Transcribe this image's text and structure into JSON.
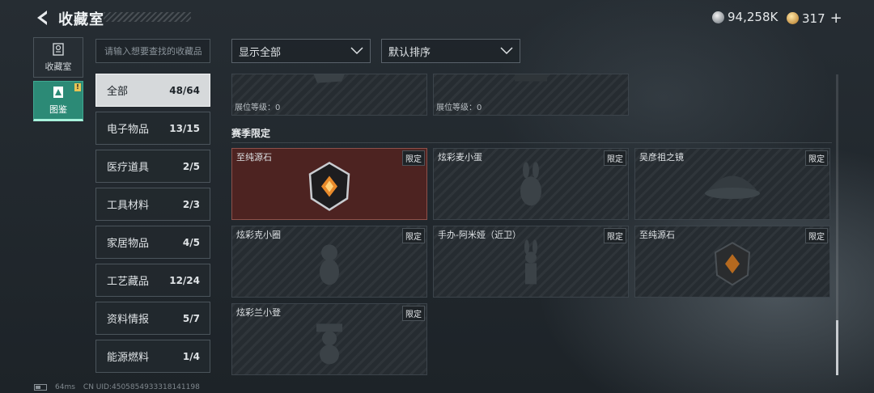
{
  "header": {
    "title": "收藏室",
    "currency_silver": "94,258K",
    "currency_gold": "317",
    "plus_label": "+"
  },
  "left_nav": {
    "tabs": [
      {
        "label": "收藏室"
      },
      {
        "label": "图鉴",
        "badge": "!"
      }
    ]
  },
  "search": {
    "placeholder": "请输入想要查找的收藏品"
  },
  "categories": [
    {
      "label": "全部",
      "count": "48/64"
    },
    {
      "label": "电子物品",
      "count": "13/15"
    },
    {
      "label": "医疗道具",
      "count": "2/5"
    },
    {
      "label": "工具材料",
      "count": "2/3"
    },
    {
      "label": "家居物品",
      "count": "4/5"
    },
    {
      "label": "工艺藏品",
      "count": "12/24"
    },
    {
      "label": "资料情报",
      "count": "5/7"
    },
    {
      "label": "能源燃料",
      "count": "1/4"
    }
  ],
  "filters": {
    "display": "显示全部",
    "sort": "默认排序"
  },
  "top_cards": [
    {
      "level": "展位等级：0"
    },
    {
      "level": "展位等级：0"
    }
  ],
  "section": {
    "title": "赛季限定"
  },
  "season_cards": [
    {
      "name": "至纯源石",
      "tag": "限定"
    },
    {
      "name": "炫彩麦小蛋",
      "tag": "限定"
    },
    {
      "name": "吴彦祖之镜",
      "tag": "限定"
    },
    {
      "name": "炫彩克小圈",
      "tag": "限定"
    },
    {
      "name": "手办-阿米娅（近卫）",
      "tag": "限定"
    },
    {
      "name": "至纯源石",
      "tag": "限定"
    },
    {
      "name": "炫彩兰小登",
      "tag": "限定"
    }
  ],
  "footer": {
    "ping": "64ms",
    "uid": "CN UID:4505854933318141198"
  },
  "colors": {
    "active_tab": "#2c8a76",
    "highlight_card": "#4d2321"
  }
}
